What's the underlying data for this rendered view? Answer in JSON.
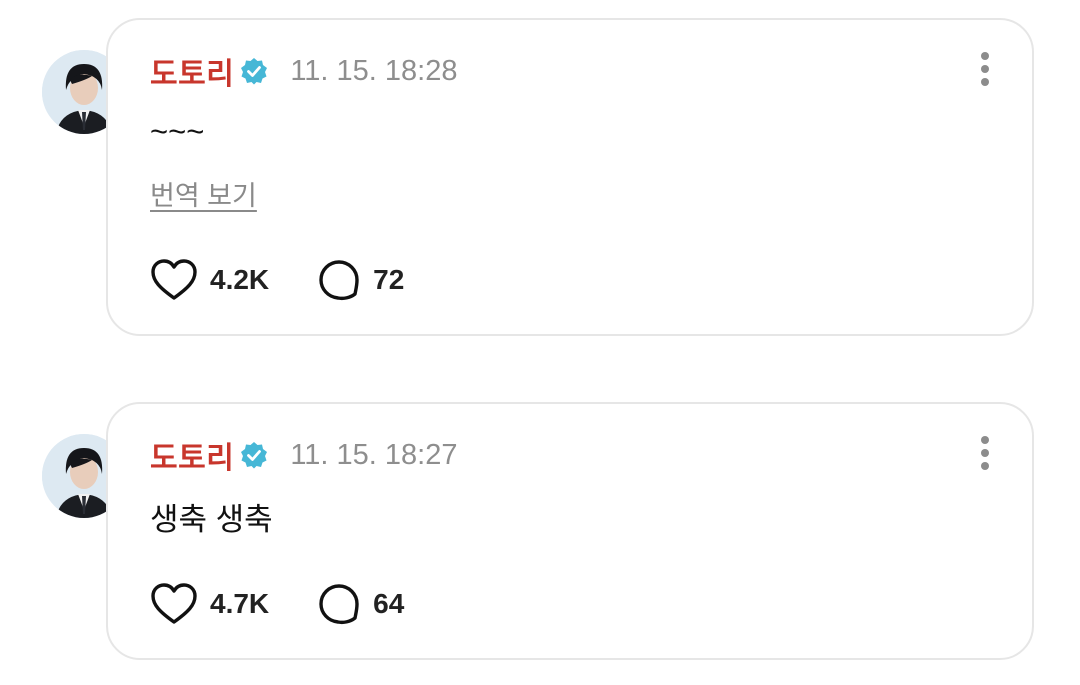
{
  "posts": [
    {
      "author": "도토리",
      "timestamp": "11. 15. 18:28",
      "text": "~~~",
      "translate_label": "번역 보기",
      "likes": "4.2K",
      "comments": "72"
    },
    {
      "author": "도토리",
      "timestamp": "11. 15. 18:27",
      "text": "생축 생축",
      "likes": "4.7K",
      "comments": "64"
    }
  ],
  "icons": {
    "verified": "verified-badge-icon",
    "like": "heart-icon",
    "comment": "speech-bubble-icon",
    "more": "more-vertical-icon"
  },
  "colors": {
    "author": "#c8362c",
    "verified": "#46b7d6",
    "timestamp": "#8e8e8e"
  }
}
